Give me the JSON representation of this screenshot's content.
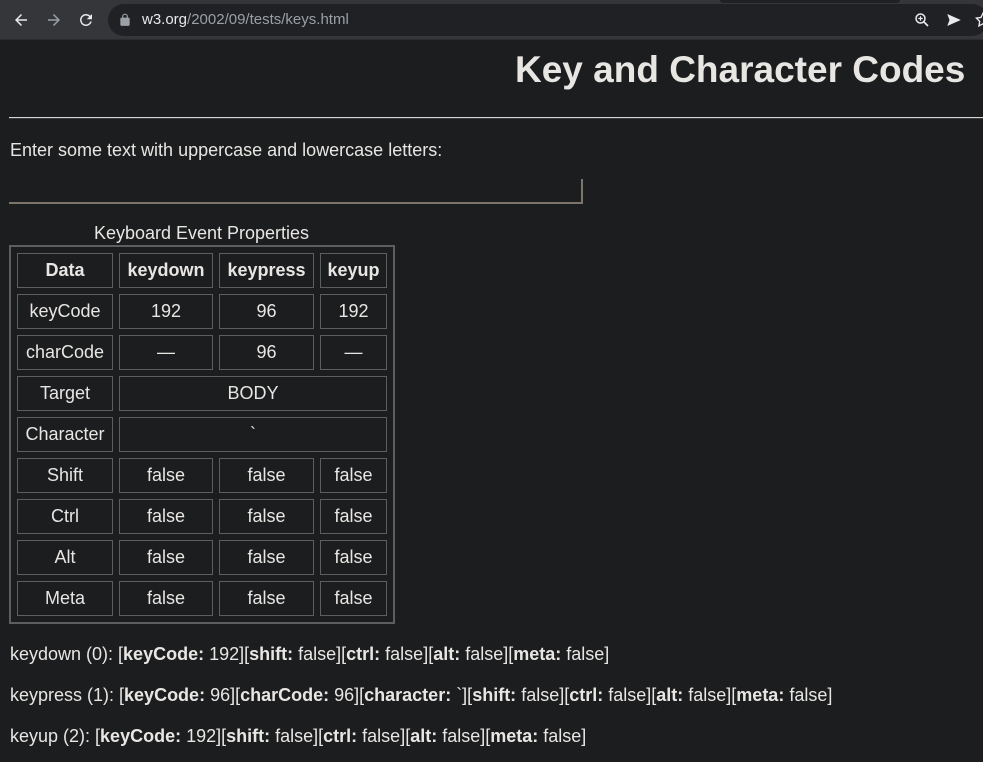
{
  "browser": {
    "url_host": "w3.org",
    "url_path": "/2002/09/tests/keys.html"
  },
  "page": {
    "title": "Key and Character Codes",
    "prompt": "Enter some text with uppercase and lowercase letters:",
    "input_value": ""
  },
  "table": {
    "caption": "Keyboard Event Properties",
    "headers": [
      "Data",
      "keydown",
      "keypress",
      "keyup"
    ],
    "rows": {
      "keycode": {
        "label": "keyCode",
        "keydown": "192",
        "keypress": "96",
        "keyup": "192"
      },
      "charcode": {
        "label": "charCode",
        "keydown": "—",
        "keypress": "96",
        "keyup": "—"
      },
      "target": {
        "label": "Target",
        "value": "BODY"
      },
      "character": {
        "label": "Character",
        "value": "`"
      },
      "shift": {
        "label": "Shift",
        "keydown": "false",
        "keypress": "false",
        "keyup": "false"
      },
      "ctrl": {
        "label": "Ctrl",
        "keydown": "false",
        "keypress": "false",
        "keyup": "false"
      },
      "alt": {
        "label": "Alt",
        "keydown": "false",
        "keypress": "false",
        "keyup": "false"
      },
      "meta": {
        "label": "Meta",
        "keydown": "false",
        "keypress": "false",
        "keyup": "false"
      }
    }
  },
  "log": {
    "keydown": {
      "prefix": "keydown (0): [",
      "fields": [
        {
          "k": "keyCode:",
          "v": " 192]["
        },
        {
          "k": "shift:",
          "v": " false]["
        },
        {
          "k": "ctrl:",
          "v": " false]["
        },
        {
          "k": "alt:",
          "v": " false]["
        },
        {
          "k": "meta:",
          "v": " false]"
        }
      ]
    },
    "keypress": {
      "prefix": "keypress (1): [",
      "fields": [
        {
          "k": "keyCode:",
          "v": " 96]["
        },
        {
          "k": "charCode:",
          "v": " 96]["
        },
        {
          "k": "character:",
          "v": " `]["
        },
        {
          "k": "shift:",
          "v": " false]["
        },
        {
          "k": "ctrl:",
          "v": " false]["
        },
        {
          "k": "alt:",
          "v": " false]["
        },
        {
          "k": "meta:",
          "v": " false]"
        }
      ]
    },
    "keyup": {
      "prefix": "keyup (2): [",
      "fields": [
        {
          "k": "keyCode:",
          "v": " 192]["
        },
        {
          "k": "shift:",
          "v": " false]["
        },
        {
          "k": "ctrl:",
          "v": " false]["
        },
        {
          "k": "alt:",
          "v": " false]["
        },
        {
          "k": "meta:",
          "v": " false]"
        }
      ]
    }
  },
  "icons": {
    "back": "back-arrow-icon",
    "forward": "forward-arrow-icon",
    "reload": "reload-icon",
    "lock": "lock-icon",
    "zoom": "zoom-icon",
    "send": "send-icon",
    "bookmark": "star-icon"
  }
}
